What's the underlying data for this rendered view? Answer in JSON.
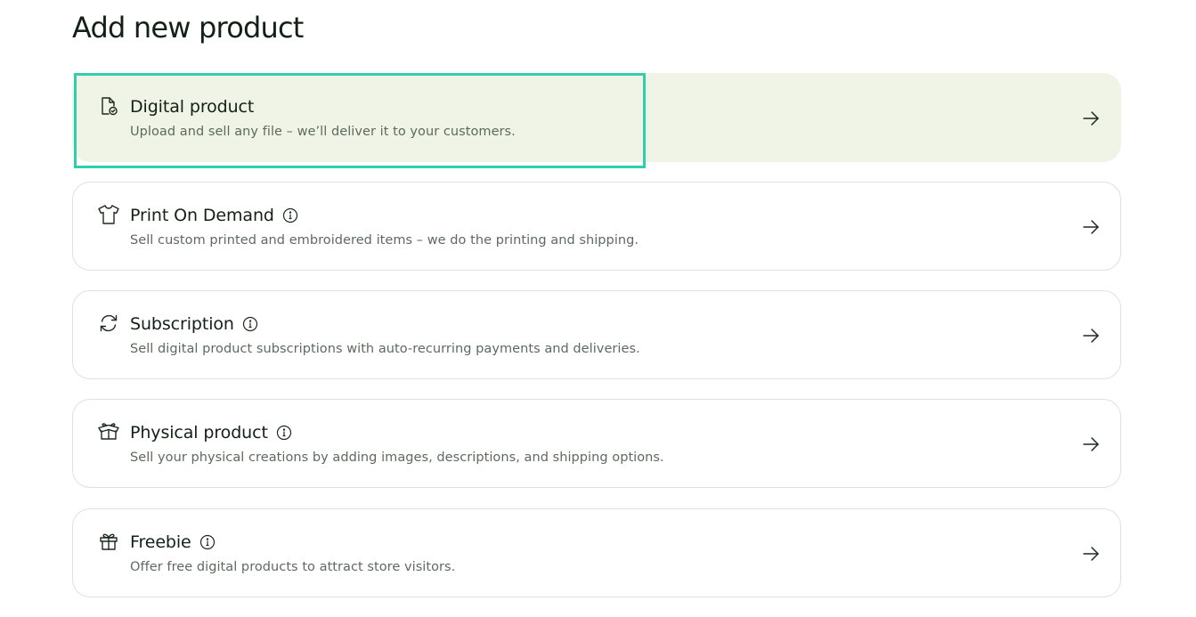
{
  "page": {
    "title": "Add new product"
  },
  "products": [
    {
      "title": "Digital product",
      "description": "Upload and sell any file – we’ll deliver it to your customers.",
      "icon": "file-check-icon",
      "has_info": false,
      "selected": true
    },
    {
      "title": "Print On Demand",
      "description": "Sell custom printed and embroidered items – we do the printing and shipping.",
      "icon": "tshirt-icon",
      "has_info": true,
      "selected": false
    },
    {
      "title": "Subscription",
      "description": "Sell digital product subscriptions with auto-recurring payments and deliveries.",
      "icon": "refresh-icon",
      "has_info": true,
      "selected": false
    },
    {
      "title": "Physical product",
      "description": "Sell your physical creations by adding images, descriptions, and shipping options.",
      "icon": "box-icon",
      "has_info": true,
      "selected": false
    },
    {
      "title": "Freebie",
      "description": "Offer free digital products to attract store visitors.",
      "icon": "gift-icon",
      "has_info": true,
      "selected": false
    }
  ],
  "colors": {
    "selected_background": "#f0f4e6",
    "highlight_border": "#2dd0ab",
    "card_border": "#dde2da",
    "title_text": "#122016",
    "description_text": "#5d6a5f"
  }
}
